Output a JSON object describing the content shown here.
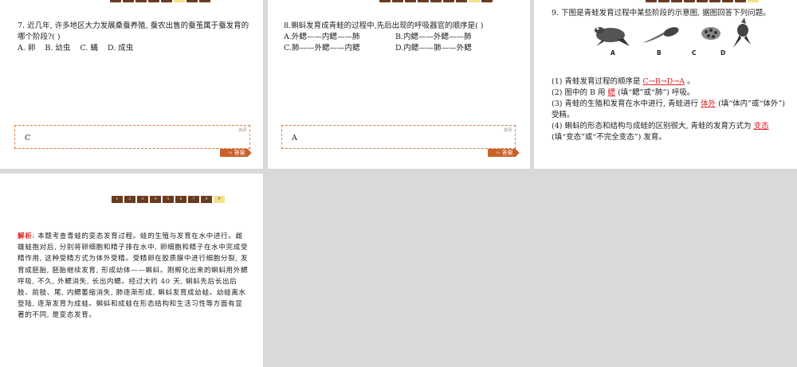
{
  "q7": {
    "text": "7. 近几年, 许多地区大力发展桑蚕养殖, 蚕农出售的蚕茧属于蚕发育的哪个阶段?( )",
    "options": [
      "A. 卵",
      "B. 幼虫",
      "C. 蛹",
      "D. 成虫"
    ],
    "answer": "C",
    "close_label": "关闭",
    "answer_button": "答案"
  },
  "q8": {
    "text": "8.蝌蚪发育成青蛙的过程中,先后出现的呼吸器官的顺序是( )",
    "options": [
      "A.外鳃——内鳃——肺",
      "B.内鳃——外鳃——肺",
      "C.肺——外鳃——内鳃",
      "D.内鳃——肺——外鳃"
    ],
    "answer": "A",
    "close_label": "关闭",
    "answer_button": "答案"
  },
  "q9": {
    "text": "9. 下图是青蛙发育过程中某些阶段的示意图, 据图回答下列问题。",
    "image_labels": [
      "A",
      "B",
      "C",
      "D"
    ],
    "sub1_pre": "(1) 青蛙发育过程的顺序是",
    "sub1_ans": "C→B→D→A",
    "sub1_post": "。",
    "sub2_pre": "(2) 图中的 B 用",
    "sub2_ans": "鳃",
    "sub2_post": "(填“鳃”或“肺”) 呼吸。",
    "sub3_pre": "(3) 青蛙的生殖和发育在水中进行, 青蛙进行",
    "sub3_ans": "体外",
    "sub3_post": "(填“体内”或“体外”) 受精。",
    "sub4_pre": "(4) 蝌蚪的形态和结构与成蛙的区别很大, 青蛙的发育方式为",
    "sub4_ans": "变态",
    "sub4_post": "(填“变态”或“不完全变态”) 发育。"
  },
  "analysis": {
    "pages": [
      "1",
      "2",
      "3",
      "4",
      "5",
      "6",
      "7",
      "8",
      "9"
    ],
    "current_page": "9",
    "tag": "解析",
    "body": ": 本题考查青蛙的变态发育过程。蛙的生殖与发育在水中进行。雌雄蛙抱对后, 分别将卵细胞和精子排在水中, 卵细胞和精子在水中完成受精作用, 这种受精方式为体外受精。受精卵在胶质膜中进行细胞分裂, 发育成胚胎, 胚胎继续发育, 形成幼体——蝌蚪。刚孵化出来的蝌蚪用外鳃呼吸, 不久, 外鳃消失, 长出内鳃。经过大约 40 天, 蝌蚪先后长出后肢、前肢、尾, 内鳃萎缩消失, 肺逐渐形成, 蝌蚪发育成幼蛙。幼蛙离水登陆, 逐渐发育为成蛙。蝌蚪和成蛙在形态结构和生活习性等方面有显著的不同, 是变态发育。"
  }
}
